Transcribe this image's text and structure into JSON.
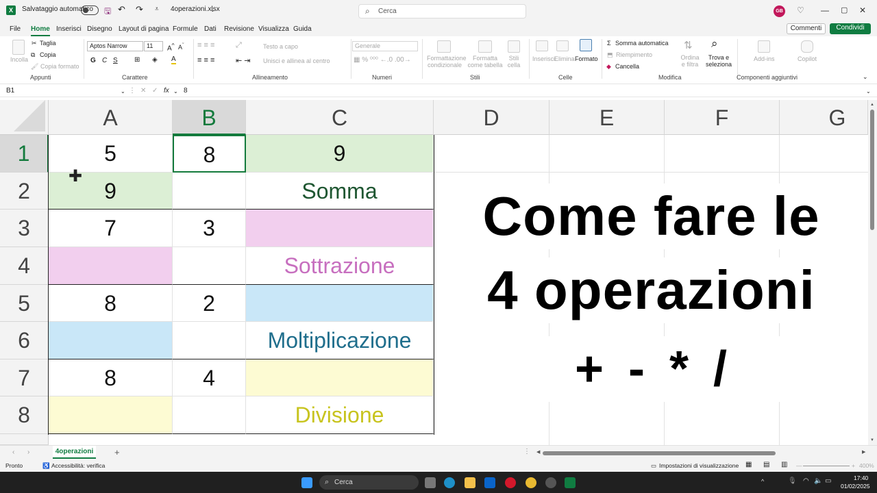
{
  "titlebar": {
    "autosave_label": "Salvataggio automatico",
    "filename": "4operazioni.xlsx",
    "search_placeholder": "Cerca",
    "avatar_initials": "GB"
  },
  "menu": {
    "items": [
      "File",
      "Home",
      "Inserisci",
      "Disegno",
      "Layout di pagina",
      "Formule",
      "Dati",
      "Revisione",
      "Visualizza",
      "Guida"
    ],
    "active": "Home",
    "comments_label": "Commenti",
    "share_label": "Condividi"
  },
  "ribbon": {
    "clipboard": {
      "paste": "Incolla",
      "cut": "Taglia",
      "copy": "Copia",
      "format_painter": "Copia formato",
      "group": "Appunti"
    },
    "font": {
      "name": "Aptos Narrow",
      "size": "11",
      "bold": "G",
      "italic": "C",
      "underline": "S",
      "group": "Carattere"
    },
    "alignment": {
      "wrap": "Testo a capo",
      "merge": "Unisci e allinea al centro",
      "group": "Allineamento"
    },
    "number": {
      "format": "Generale",
      "group": "Numeri"
    },
    "styles": {
      "conditional": "Formattazione condizionale",
      "table": "Formatta come tabella",
      "cell_styles": "Stili cella",
      "group": "Stili"
    },
    "cells": {
      "insert": "Inserisci",
      "delete": "Elimina",
      "format": "Formato",
      "group": "Celle"
    },
    "editing": {
      "autosum": "Somma automatica",
      "fill": "Riempimento",
      "clear": "Cancella",
      "sort": "Ordina e filtra",
      "find": "Trova e seleziona",
      "group": "Modifica"
    },
    "addins": {
      "addins": "Add-ins",
      "copilot": "Copilot",
      "group": "Componenti aggiuntivi"
    }
  },
  "formula_bar": {
    "name_box": "B1",
    "fx": "fx",
    "value": "8"
  },
  "columns": [
    "A",
    "B",
    "C",
    "D",
    "E",
    "F",
    "G"
  ],
  "selected_column": "B",
  "rows": [
    "1",
    "2",
    "3",
    "4",
    "5",
    "6",
    "7",
    "8"
  ],
  "selected_row": "1",
  "cells": {
    "A1": "5",
    "B1": "8",
    "C1": "9",
    "A2": "9",
    "C2": "Somma",
    "A3": "7",
    "B3": "3",
    "C4": "Sottrazione",
    "A5": "8",
    "B5": "2",
    "C6": "Moltiplicazione",
    "A7": "8",
    "B7": "4",
    "C8": "Divisione"
  },
  "overlay_text": {
    "line1": "Come fare le",
    "line2": "4 operazioni",
    "line3": "+ - * /"
  },
  "colors": {
    "green_fill": "#dcefd5",
    "green_text": "#1e5631",
    "pink_fill": "#f2cfee",
    "pink_text": "#c76fbf",
    "blue_fill": "#c9e7f8",
    "blue_text": "#1f6e8c",
    "yellow_fill": "#fdfbd3",
    "yellow_text": "#c8c41f",
    "excel_green": "#107c41"
  },
  "sheet": {
    "tab": "4operazioni"
  },
  "status": {
    "ready": "Pronto",
    "accessibility": "Accessibilità: verifica",
    "display_settings": "Impostazioni di visualizzazione",
    "zoom": "400%"
  },
  "taskbar": {
    "search": "Cerca",
    "time": "17:40",
    "date": "01/02/2025"
  }
}
